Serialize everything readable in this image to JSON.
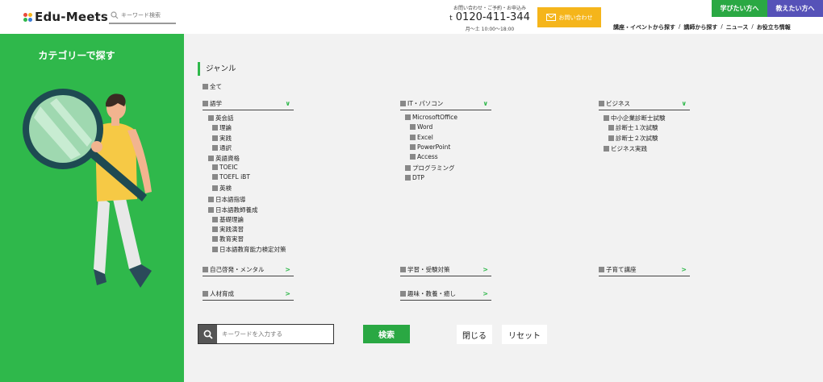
{
  "header": {
    "logo_text": "Edu-Meets",
    "search_placeholder": "キーワード検索",
    "contact_line1": "お問い合わせ・ご予約・お申込み",
    "phone": "0120-411-344",
    "phone_prefix": "t",
    "hours": "月〜土 10:00〜18:00",
    "mail_button": "お問い合わせ",
    "learn_button": "学びたい方へ",
    "teach_button": "教えたい方へ",
    "nav": [
      "講座・イベントから探す",
      "講師から探す",
      "ニュース",
      "お役立ち情報"
    ],
    "nav_sep": "/"
  },
  "sidebar": {
    "title": "カテゴリーで探す"
  },
  "genre": {
    "title": "ジャンル",
    "all_label": "全て",
    "col1": {
      "cat": "語学",
      "items": [
        "英会話",
        "理論",
        "実践",
        "通訳",
        "英語資格",
        "TOEIC",
        "TOEFL iBT",
        "英検",
        "日本語指導",
        "日本語教師養成",
        "基礎理論",
        "実践演習",
        "教育実習",
        "日本語教育能力検定対策"
      ]
    },
    "col2": {
      "cat": "IT・パソコン",
      "items": [
        "MicrosoftOffice",
        "Word",
        "Excel",
        "PowerPoint",
        "Access",
        "プログラミング",
        "DTP"
      ]
    },
    "col3": {
      "cat": "ビジネス",
      "items": [
        "中小企業診断士試験",
        "診断士１次試験",
        "診断士２次試験",
        "ビジネス実践"
      ]
    },
    "collapsed": [
      "自己啓発・メンタル",
      "学習・受験対策",
      "子育て講座",
      "人材育成",
      "趣味・教養・癒し"
    ],
    "arrow_down": "∨",
    "arrow_right": ">"
  },
  "search": {
    "placeholder": "キーワードを入力する",
    "search_button": "検索",
    "close_button": "閉じる",
    "reset_button": "リセット"
  },
  "colors": {
    "brand_green": "#2fb84b",
    "button_green": "#2aa843",
    "purple": "#5652b8",
    "orange": "#f5b51b"
  }
}
